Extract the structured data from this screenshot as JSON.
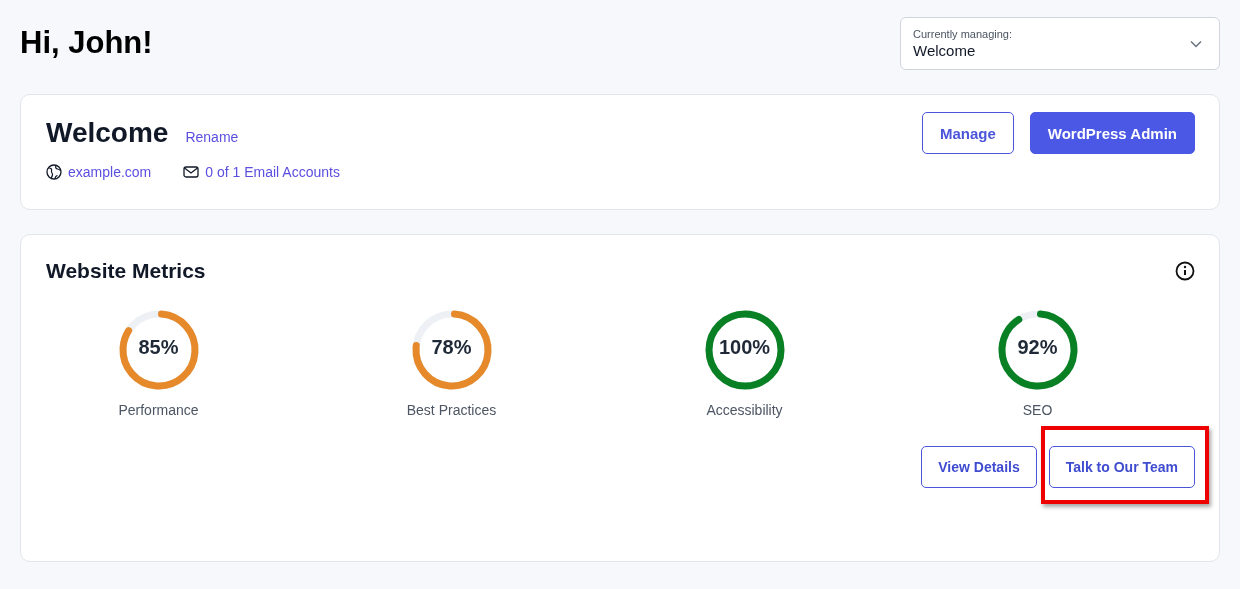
{
  "greeting": "Hi, John!",
  "site_selector": {
    "label": "Currently managing:",
    "value": "Welcome"
  },
  "site_card": {
    "title": "Welcome",
    "rename_link": "Rename",
    "domain": "example.com",
    "email_accounts": "0 of 1 Email Accounts",
    "buttons": [
      {
        "label": "Manage",
        "kind": "outline"
      },
      {
        "label": "WordPress Admin",
        "kind": "primary"
      }
    ]
  },
  "metrics_card": {
    "title": "Website Metrics",
    "metrics": [
      {
        "value": "85%",
        "name": "Performance",
        "color": "#e5892a"
      },
      {
        "value": "78%",
        "name": "Best Practices",
        "color": "#e5892a"
      },
      {
        "value": "100%",
        "name": "Accessibility",
        "color": "#0a8025"
      },
      {
        "value": "92%",
        "name": "SEO",
        "color": "#0a8025"
      }
    ],
    "buttons": [
      {
        "label": "View Details",
        "highlighted": false
      },
      {
        "label": "Talk to Our Team",
        "highlighted": true
      }
    ]
  }
}
